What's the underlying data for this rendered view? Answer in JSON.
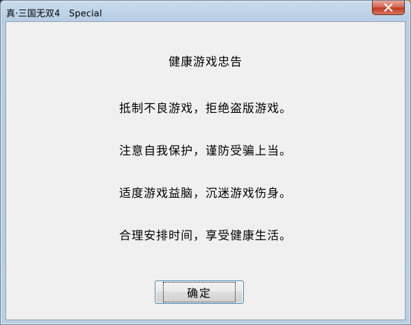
{
  "window": {
    "title": "真·三国无双4   Special"
  },
  "dialog": {
    "heading": "健康游戏忠告",
    "lines": [
      "抵制不良游戏，拒绝盗版游戏。",
      "注意自我保护，谨防受骗上当。",
      "适度游戏益脑，沉迷游戏伤身。",
      "合理安排时间，享受健康生活。"
    ],
    "ok_label": "确定"
  },
  "icons": {
    "close": "close-icon"
  }
}
